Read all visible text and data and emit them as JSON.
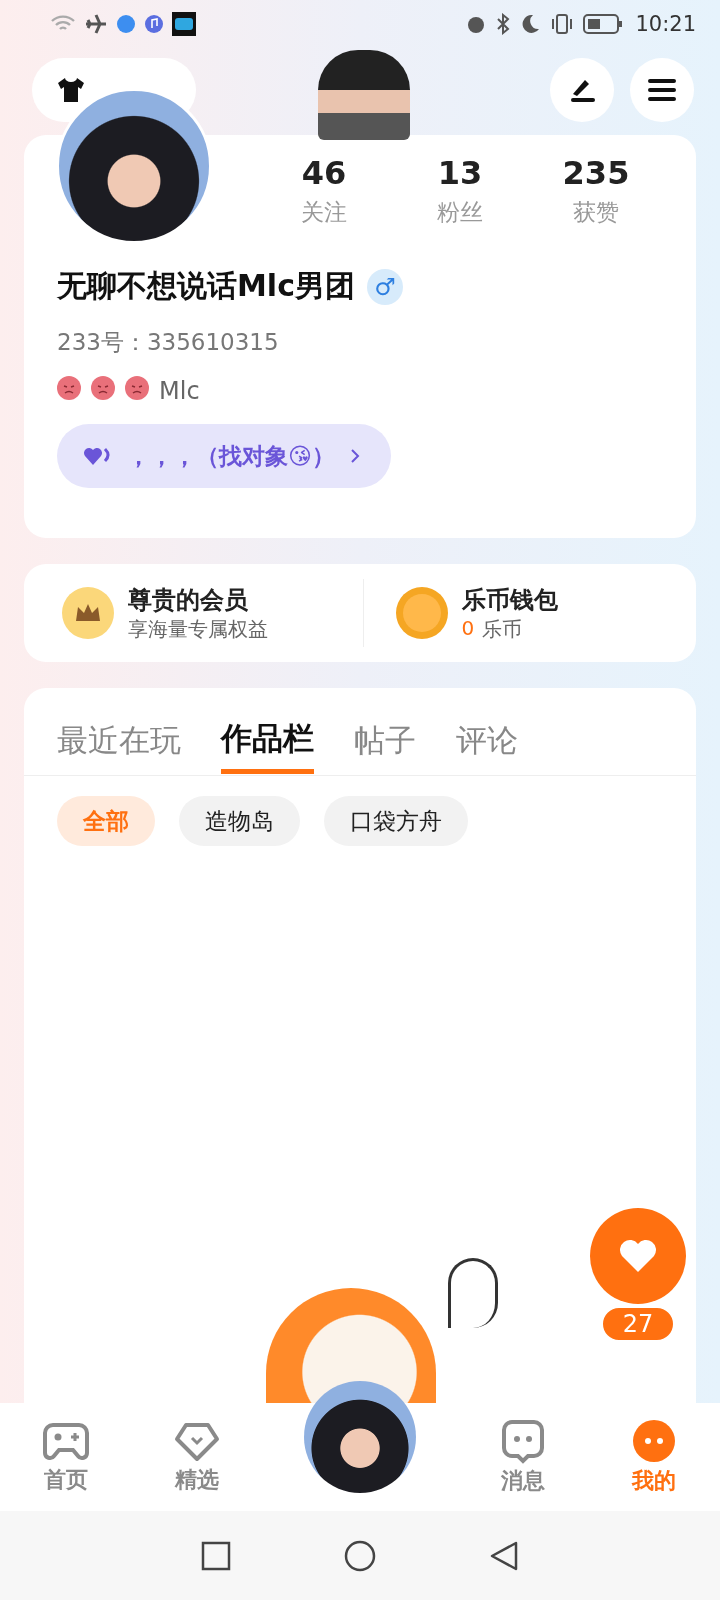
{
  "status_bar": {
    "time": "10:21"
  },
  "profile": {
    "stats": [
      {
        "value": "46",
        "label": "关注"
      },
      {
        "value": "13",
        "label": "粉丝"
      },
      {
        "value": "235",
        "label": "获赞"
      }
    ],
    "name": "无聊不想说话Mlc男团",
    "gender": "♂",
    "id_text": "233号：335610315",
    "signature_emojis": [
      {
        "kind": "angry"
      },
      {
        "kind": "angry"
      },
      {
        "kind": "angry"
      }
    ],
    "signature": "Mlc",
    "tag": "，，，（找对象😘）"
  },
  "perks": [
    {
      "kind": "vip",
      "title": "尊贵的会员",
      "subtitle": "享海量专属权益"
    },
    {
      "kind": "wallet",
      "title": "乐币钱包",
      "amount": "0",
      "unit": "乐币"
    }
  ],
  "tabs": [
    {
      "label": "最近在玩",
      "selected": false
    },
    {
      "label": "作品栏",
      "selected": true
    },
    {
      "label": "帖子",
      "selected": false
    },
    {
      "label": "评论",
      "selected": false
    }
  ],
  "chips": [
    {
      "label": "全部",
      "selected": true
    },
    {
      "label": "造物岛",
      "selected": false
    },
    {
      "label": "口袋方舟",
      "selected": false
    }
  ],
  "like_button": {
    "count": "27"
  },
  "bottom_nav": [
    {
      "kind": "game",
      "label": "首页",
      "selected": false
    },
    {
      "kind": "heart",
      "label": "精选",
      "selected": false
    },
    {
      "kind": "avatar",
      "selected": false
    },
    {
      "kind": "chat",
      "label": "消息",
      "selected": false
    },
    {
      "kind": "me",
      "label": "我的",
      "selected": true
    }
  ]
}
